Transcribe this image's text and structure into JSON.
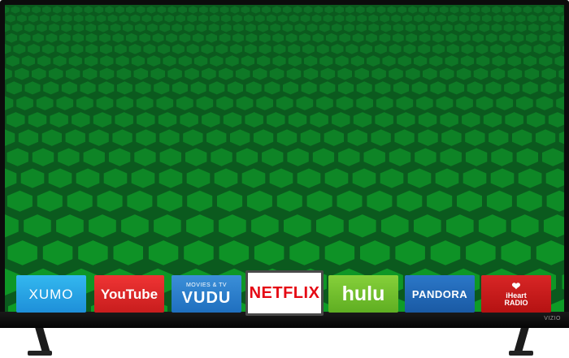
{
  "device": {
    "brand": "VIZIO"
  },
  "apps": [
    {
      "id": "xumo",
      "label": "XUMO"
    },
    {
      "id": "youtube",
      "label": "YouTube"
    },
    {
      "id": "vudu",
      "label": "VUDU",
      "sublabel": "MOVIES & TV"
    },
    {
      "id": "netflix",
      "label": "NETFLIX",
      "selected": true
    },
    {
      "id": "hulu",
      "label": "hulu"
    },
    {
      "id": "pandora",
      "label": "PANDORA"
    },
    {
      "id": "iheart",
      "label_line1": "iHeart",
      "label_line2": "RADIO"
    }
  ],
  "colors": {
    "screen_background": "#0b5a1e",
    "hex_cell": "#13882f",
    "netflix_red": "#e50914"
  }
}
